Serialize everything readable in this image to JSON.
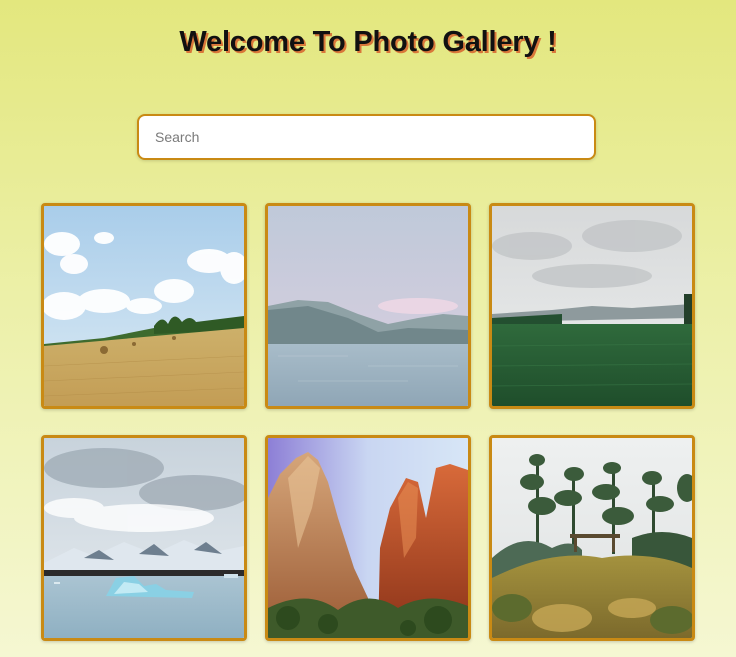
{
  "header": {
    "title": "Welcome To Photo Gallery !"
  },
  "search": {
    "placeholder": "Search",
    "value": ""
  },
  "gallery": {
    "photos": [
      {
        "subject": "hay-field-blue-sky"
      },
      {
        "subject": "lake-mountains-pink-sky"
      },
      {
        "subject": "green-valley-cloudy"
      },
      {
        "subject": "glacier-lagoon-icebergs"
      },
      {
        "subject": "red-rock-canyon"
      },
      {
        "subject": "garden-trees-bushes"
      }
    ]
  },
  "colors": {
    "accent_border": "#c98a14",
    "title_shadow": "#d9773a",
    "background_top": "#e3e77e",
    "background_bottom": "#f5f7d2"
  }
}
